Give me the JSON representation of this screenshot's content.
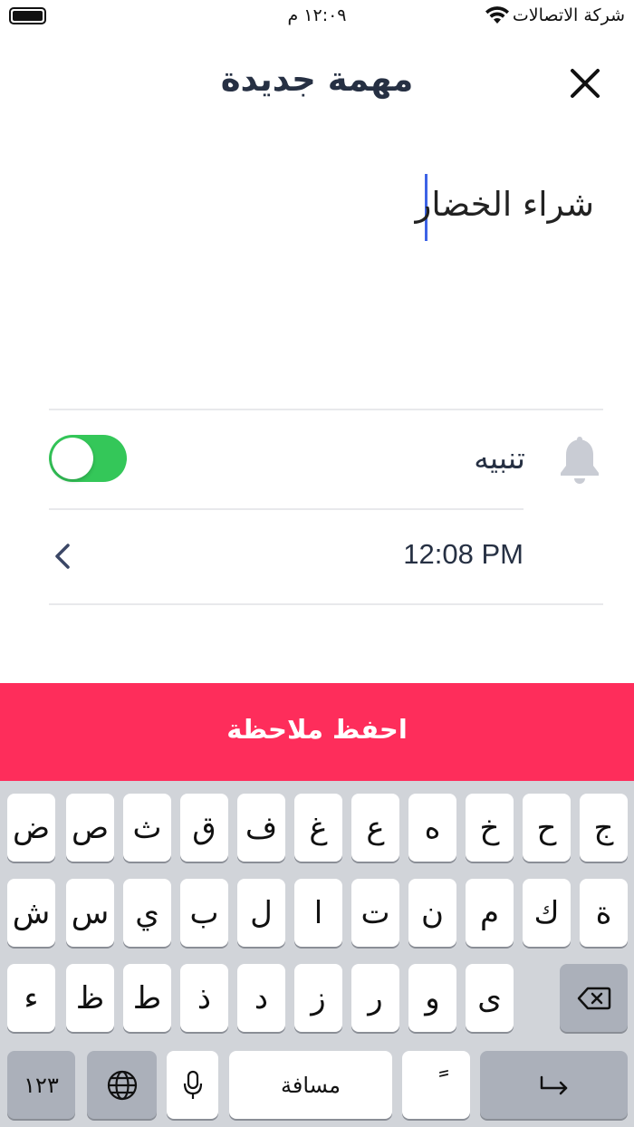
{
  "status_bar": {
    "time": "١٢:٠٩ م",
    "carrier": "شركة الاتصالات",
    "wifi_icon": "wifi-icon",
    "battery_icon": "battery-icon"
  },
  "header": {
    "title": "مهمة جديدة",
    "close_icon": "close-icon"
  },
  "task": {
    "text": "شراء الخضار"
  },
  "reminder": {
    "label": "تنبيه",
    "icon": "bell-icon",
    "enabled": true
  },
  "time_row": {
    "value": "12:08 PM",
    "icon": "chevron-left-icon"
  },
  "save_button": {
    "label": "احفظ ملاحظة",
    "color": "#fe2d5b"
  },
  "keyboard": {
    "row1": [
      "ج",
      "ح",
      "خ",
      "ه",
      "ع",
      "غ",
      "ف",
      "ق",
      "ث",
      "ص",
      "ض"
    ],
    "row2": [
      "ة",
      "ك",
      "م",
      "ن",
      "ت",
      "ا",
      "ل",
      "ب",
      "ي",
      "س",
      "ش"
    ],
    "row3": [
      "ى",
      "و",
      "ر",
      "ز",
      "د",
      "ذ",
      "ط",
      "ظ",
      "ء"
    ],
    "numbers_key": "١٢٣",
    "space_key": "مسافة",
    "diacritic_key": "ً",
    "globe_icon": "globe-icon",
    "mic_icon": "microphone-icon",
    "delete_icon": "backspace-icon",
    "return_icon": "return-icon"
  },
  "colors": {
    "accent": "#fe2d5b",
    "toggle_on": "#34c759",
    "caret": "#3d63e6",
    "text_dark": "#263043"
  }
}
